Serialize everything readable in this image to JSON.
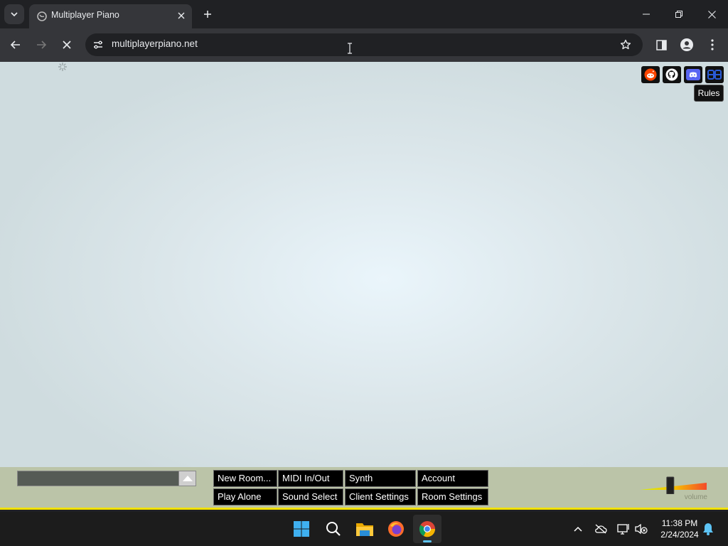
{
  "browser": {
    "tab_title": "Multiplayer Piano",
    "url": "multiplayerpiano.net"
  },
  "page": {
    "social_links": [
      {
        "icon": "reddit-icon",
        "color": "#ff4500"
      },
      {
        "icon": "github-icon",
        "color": "#000000"
      },
      {
        "icon": "discord-icon",
        "color": "#5865f2"
      },
      {
        "icon": "bb-icon",
        "color": "#1e3a8a"
      }
    ],
    "rules_tooltip": "Rules",
    "buttons": {
      "new_room": "New Room...",
      "play_alone": "Play Alone",
      "midi": "MIDI In/Out",
      "sound_select": "Sound Select",
      "synth": "Synth",
      "client_settings": "Client Settings",
      "account": "Account",
      "room_settings": "Room Settings"
    },
    "volume_label": "volume",
    "volume_level": 0.45
  },
  "taskbar": {
    "time": "11:38 PM",
    "date": "2/24/2024"
  }
}
